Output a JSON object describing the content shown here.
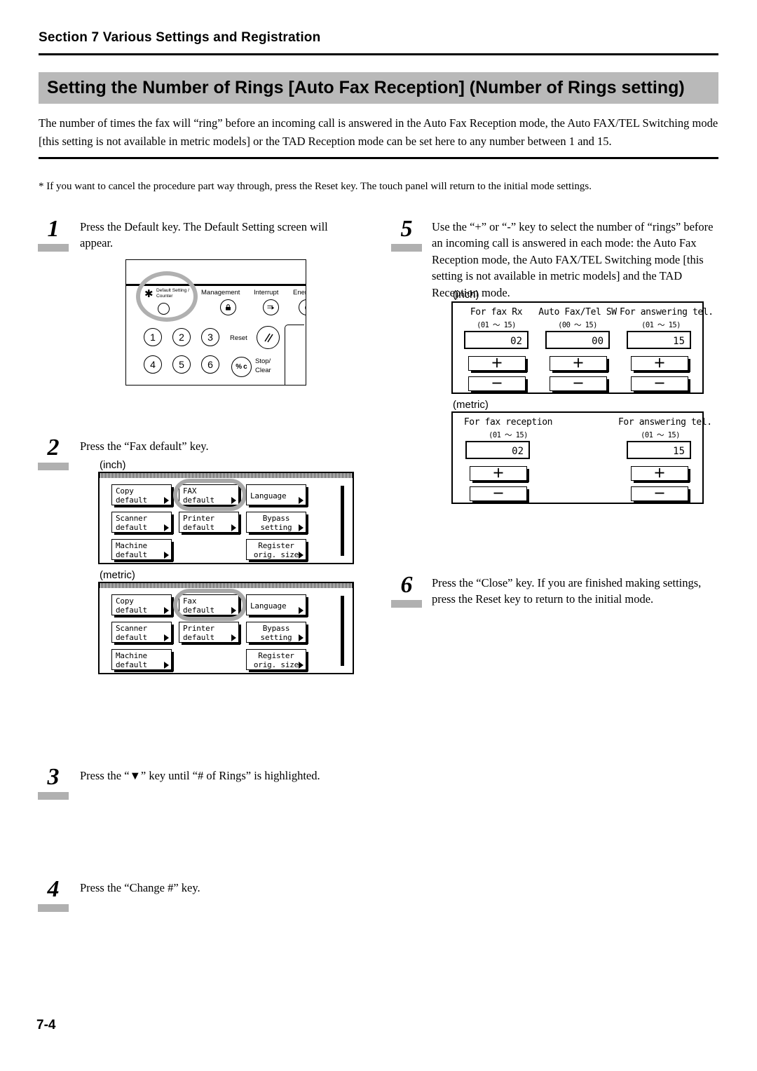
{
  "header": {
    "section": "Section 7  Various Settings and Registration",
    "title": "Setting the Number of Rings [Auto Fax Reception]  (Number of Rings setting)",
    "intro": "The number of times the fax will “ring” before an incoming call is answered in the Auto Fax Reception mode, the Auto FAX/TEL Switching mode [this setting is not available in metric models] or the TAD Reception mode can be set here to any number between 1 and 15.",
    "note": "*  If you want to cancel the procedure part way through, press the Reset key. The touch panel will return to the initial mode settings."
  },
  "steps": {
    "s1": {
      "num": "1",
      "text": "Press the Default key. The Default Setting screen will appear."
    },
    "s2": {
      "num": "2",
      "text": "Press the “Fax default” key."
    },
    "s3": {
      "num": "3",
      "text": "Press the “▼” key until “# of Rings” is highlighted."
    },
    "s4": {
      "num": "4",
      "text": "Press the “Change #” key."
    },
    "s5": {
      "num": "5",
      "text": "Use the “+” or “-” key to select the number of “rings” before an incoming call is answered in each mode: the Auto Fax Reception mode, the Auto FAX/TEL Switching mode [this setting is not available in metric models] and the TAD Reception mode."
    },
    "s6": {
      "num": "6",
      "text": "Press the “Close” key. If you are finished making settings, press the Reset key to return to the initial mode."
    }
  },
  "control_panel": {
    "labels": {
      "default_setting_line1": "Default Setting /",
      "default_setting_line2": "Counter",
      "management": "Management",
      "interrupt": "Interrupt",
      "energy": "Energ",
      "reset": "Reset",
      "stop_line1": "Stop/",
      "stop_line2": "Clear",
      "star": "✱",
      "lock_icon_glyph": "\u0001",
      "percent_c": "% c"
    },
    "numeric_keys": [
      "1",
      "2",
      "3",
      "4",
      "5",
      "6"
    ]
  },
  "default_screens": {
    "inch_label": "(inch)",
    "metric_label": "(metric)",
    "inch_keys": [
      {
        "l1": "Copy",
        "l2": "default"
      },
      {
        "l1": "FAX",
        "l2": "default"
      },
      {
        "l1": "Language",
        "l2": ""
      },
      {
        "l1": "Scanner",
        "l2": "default"
      },
      {
        "l1": "Printer",
        "l2": "default"
      },
      {
        "l1": "Bypass",
        "l2": "setting"
      },
      {
        "l1": "Machine",
        "l2": "default"
      },
      {
        "l1": "Register",
        "l2": "orig. size"
      }
    ],
    "metric_keys": [
      {
        "l1": "Copy",
        "l2": "default"
      },
      {
        "l1": "Fax",
        "l2": "default"
      },
      {
        "l1": "Language",
        "l2": ""
      },
      {
        "l1": "Scanner",
        "l2": "default"
      },
      {
        "l1": "Printer",
        "l2": "default"
      },
      {
        "l1": "Bypass",
        "l2": "setting"
      },
      {
        "l1": "Machine",
        "l2": "default"
      },
      {
        "l1": "Register",
        "l2": "orig. size"
      }
    ],
    "highlighted_key_inch": "FAX default",
    "highlighted_key_metric": "Fax default"
  },
  "rings_screens": {
    "inch_label": "(inch)",
    "metric_label": "(metric)",
    "inch_columns": [
      {
        "title": "For fax Rx",
        "range": "(01 ～ 15)",
        "value": "02",
        "plus": "＋",
        "minus": "－"
      },
      {
        "title": "Auto Fax/Tel SW",
        "range": "(00 ～ 15)",
        "value": "00",
        "plus": "＋",
        "minus": "－"
      },
      {
        "title": "For answering tel.",
        "range": "(01 ～ 15)",
        "value": "15",
        "plus": "＋",
        "minus": "－"
      }
    ],
    "metric_columns": [
      {
        "title": "For fax reception",
        "range": "(01 ～ 15)",
        "value": "02",
        "plus": "＋",
        "minus": "－"
      },
      {
        "title": "For answering tel.",
        "range": "(01 ～ 15)",
        "value": "15",
        "plus": "＋",
        "minus": "－"
      }
    ]
  },
  "footer": {
    "page": "7-4"
  },
  "colors": {
    "title_bar_gray": "#b9b9b9",
    "step_bar_gray": "#b0b0b0",
    "highlight_ring_gray": "#a8a8a8"
  }
}
